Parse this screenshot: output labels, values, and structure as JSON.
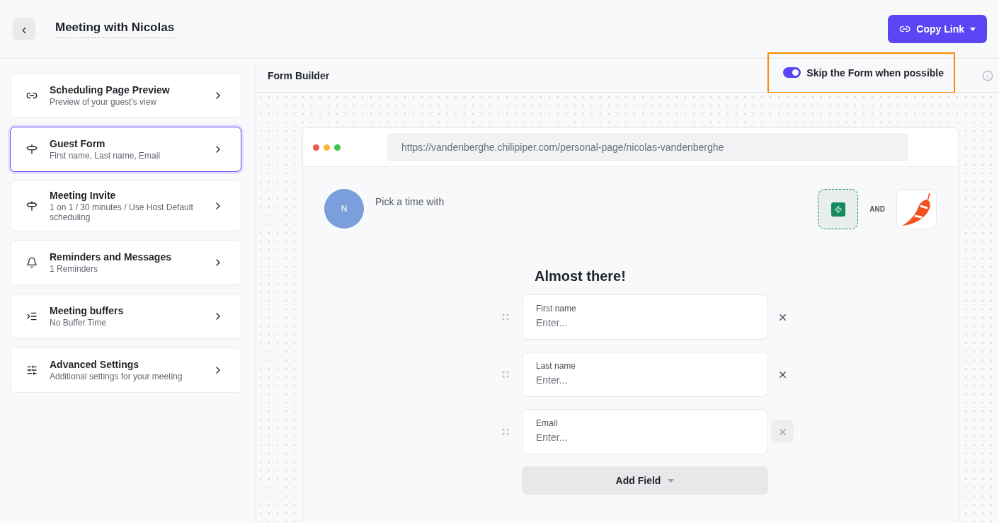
{
  "header": {
    "back": "‹",
    "title": "Meeting with Nicolas",
    "copy_button": "Copy Link"
  },
  "sidebar": {
    "items": [
      {
        "title": "Scheduling Page Preview",
        "subtitle": "Preview of your guest's view",
        "selected": false
      },
      {
        "title": "Guest Form",
        "subtitle": "First name, Last name, Email",
        "selected": true
      },
      {
        "title": "Meeting Invite",
        "subtitle": "1 on 1 / 30 minutes / Use Host Default scheduling",
        "selected": false
      },
      {
        "title": "Reminders and Messages",
        "subtitle": "1 Reminders",
        "selected": false
      },
      {
        "title": "Meeting buffers",
        "subtitle": "No Buffer Time",
        "selected": false
      },
      {
        "title": "Advanced Settings",
        "subtitle": "Additional settings for your meeting",
        "selected": false
      }
    ]
  },
  "toolbar": {
    "title": "Form Builder",
    "skip_toggle": {
      "label": "Skip the Form when possible",
      "on": true,
      "highlighted": true
    }
  },
  "preview": {
    "url": "https://vandenberghe.chilipiper.com/personal-page/nicolas-vandenberghe",
    "avatar": "N",
    "pick_text": "Pick a time with",
    "and_label": "AND",
    "form_title": "Almost there!",
    "fields": [
      {
        "label": "First name",
        "placeholder": "Enter...",
        "hovered": false
      },
      {
        "label": "Last name",
        "placeholder": "Enter...",
        "hovered": false
      },
      {
        "label": "Email",
        "placeholder": "Enter...",
        "hovered": true
      }
    ],
    "add_field": "Add Field"
  }
}
